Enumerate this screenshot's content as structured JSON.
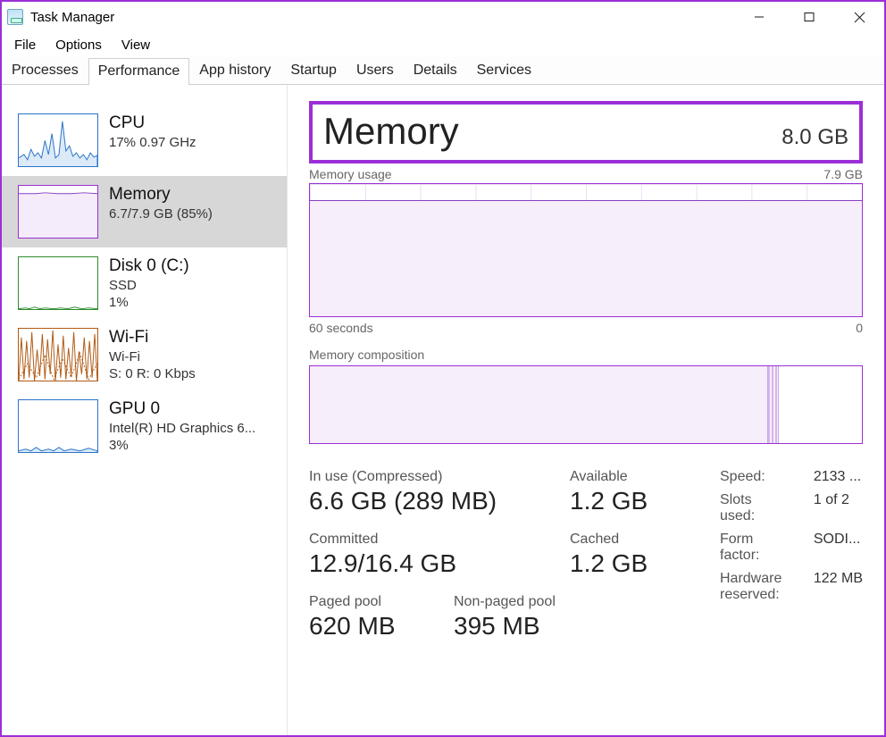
{
  "window": {
    "title": "Task Manager"
  },
  "menu": {
    "file": "File",
    "options": "Options",
    "view": "View"
  },
  "tabs": {
    "processes": "Processes",
    "performance": "Performance",
    "app_history": "App history",
    "startup": "Startup",
    "users": "Users",
    "details": "Details",
    "services": "Services"
  },
  "sidebar": {
    "cpu": {
      "title": "CPU",
      "line": "17%  0.97 GHz"
    },
    "memory": {
      "title": "Memory",
      "line": "6.7/7.9 GB (85%)"
    },
    "disk": {
      "title": "Disk 0 (C:)",
      "sub1": "SSD",
      "sub2": "1%"
    },
    "wifi": {
      "title": "Wi-Fi",
      "sub1": "Wi-Fi",
      "sub2": "S: 0  R: 0 Kbps"
    },
    "gpu": {
      "title": "GPU 0",
      "sub1": "Intel(R) HD Graphics 6...",
      "sub2": "3%"
    }
  },
  "header": {
    "title": "Memory",
    "total": "8.0 GB"
  },
  "usage_graph": {
    "left_label": "Memory usage",
    "right_label": "7.9 GB",
    "time_left": "60 seconds",
    "time_right": "0"
  },
  "composition": {
    "label": "Memory composition"
  },
  "stats": {
    "in_use_label": "In use (Compressed)",
    "in_use_value": "6.6 GB (289 MB)",
    "available_label": "Available",
    "available_value": "1.2 GB",
    "committed_label": "Committed",
    "committed_value": "12.9/16.4 GB",
    "cached_label": "Cached",
    "cached_value": "1.2 GB",
    "paged_label": "Paged pool",
    "paged_value": "620 MB",
    "nonpaged_label": "Non-paged pool",
    "nonpaged_value": "395 MB"
  },
  "hw": {
    "speed_k": "Speed:",
    "speed_v": "2133 ...",
    "slots_k": "Slots used:",
    "slots_v": "1 of 2",
    "form_k": "Form factor:",
    "form_v": "SODI...",
    "reserved_k": "Hardware reserved:",
    "reserved_v": "122 MB"
  }
}
